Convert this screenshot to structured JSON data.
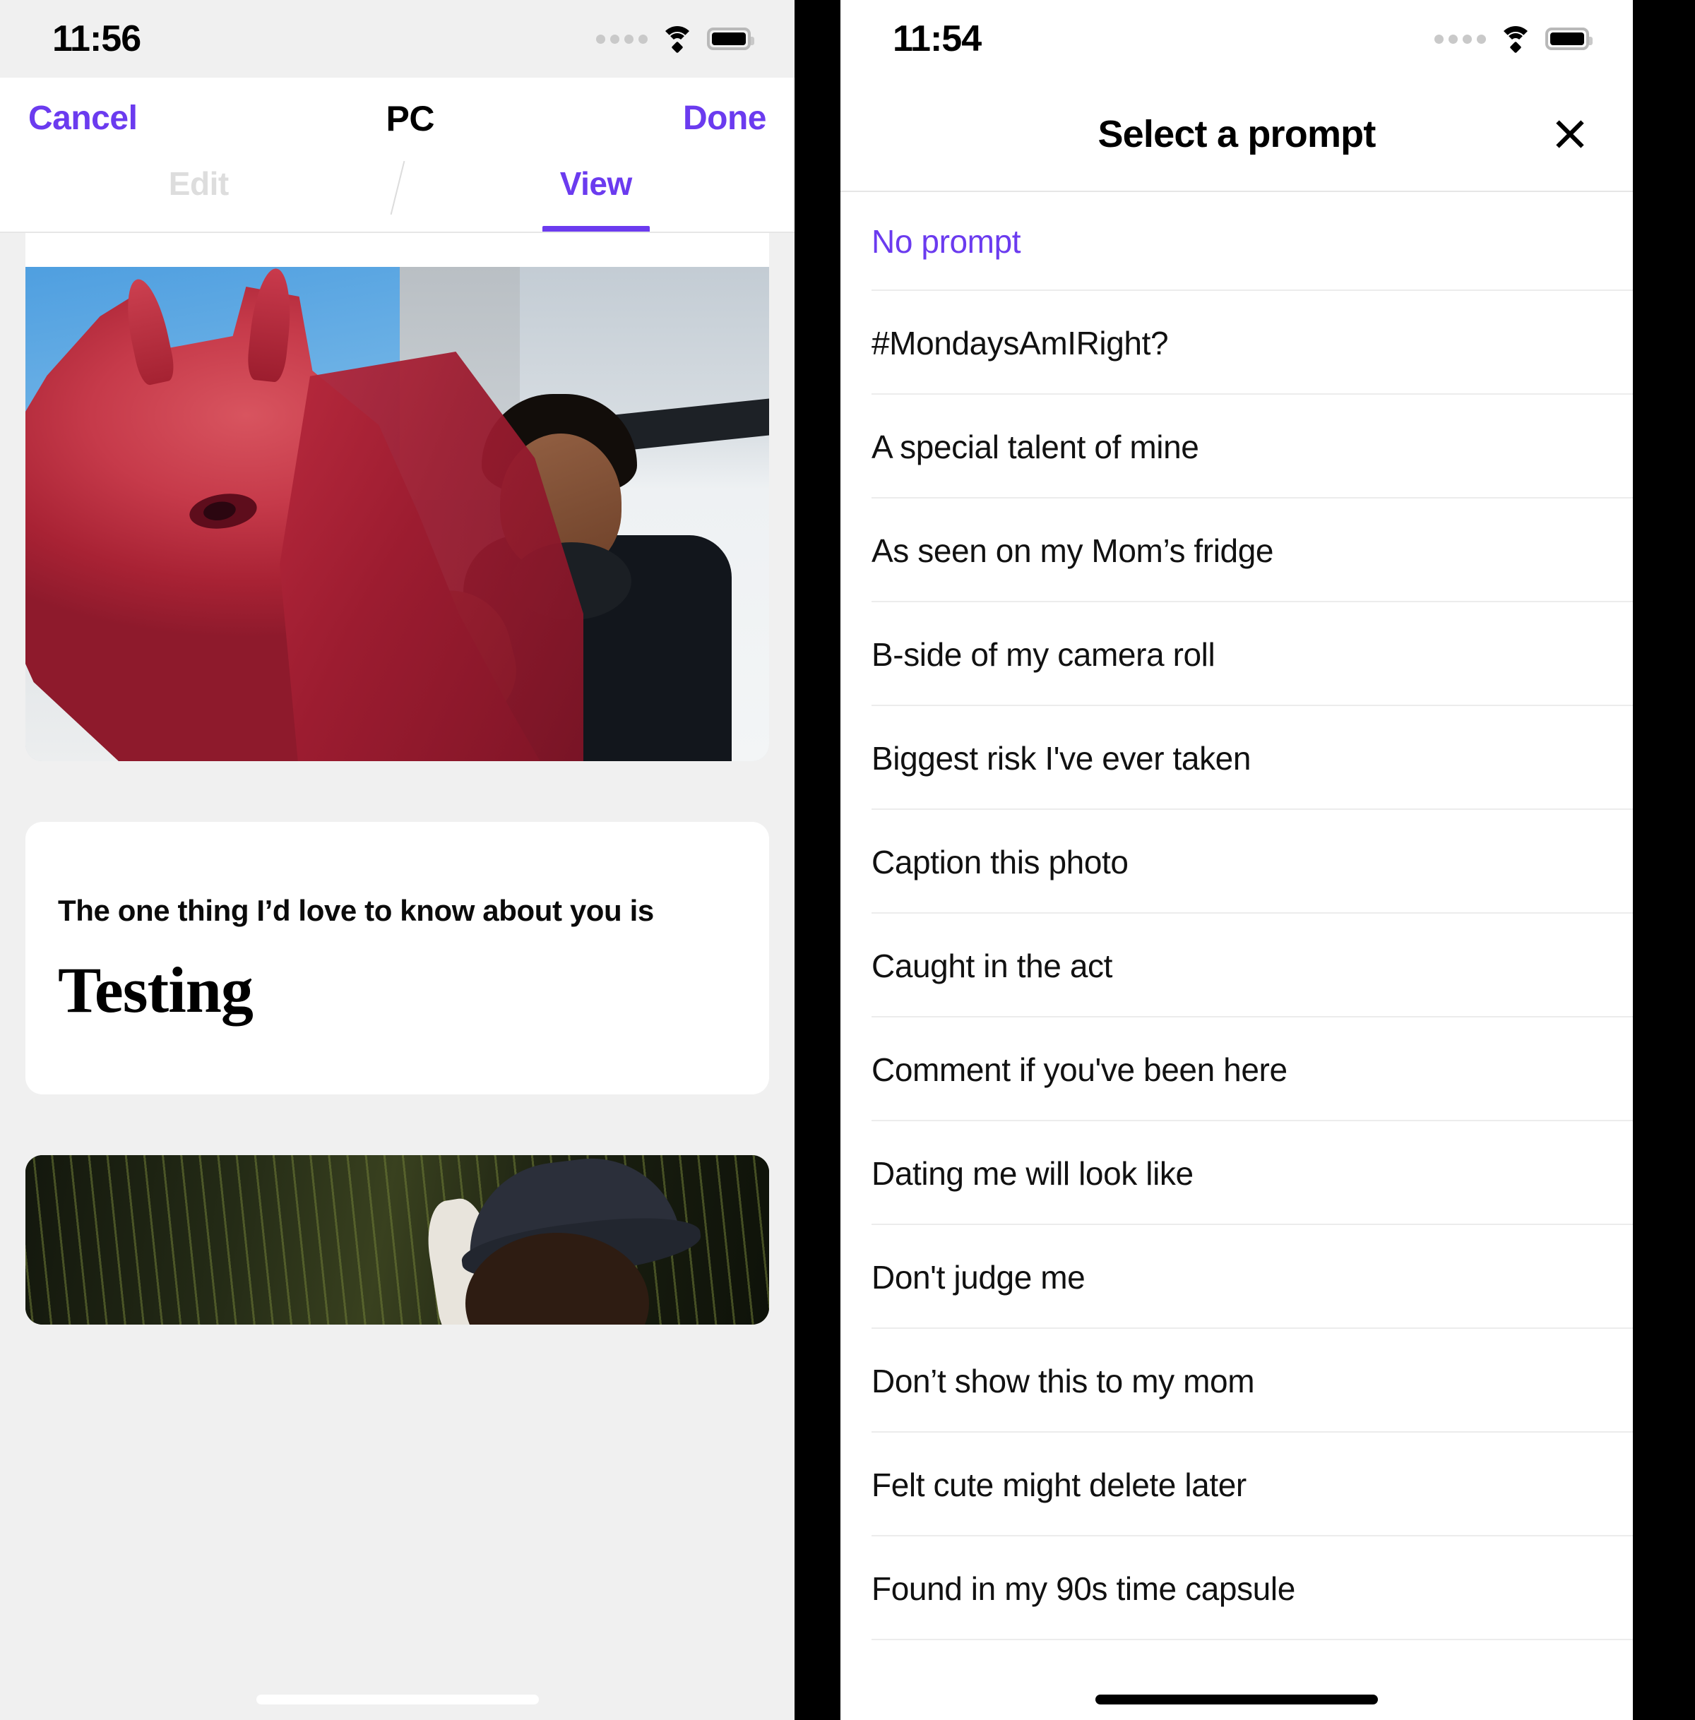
{
  "left_screen": {
    "status_bar": {
      "time": "11:56",
      "cellular_icon": "cellular-dots-icon",
      "wifi_icon": "wifi-icon",
      "battery_icon": "battery-full-icon"
    },
    "nav": {
      "cancel_label": "Cancel",
      "title": "PC",
      "done_label": "Done"
    },
    "tabs": [
      {
        "label": "Edit",
        "active": false
      },
      {
        "label": "View",
        "active": true
      }
    ],
    "prompt_card": {
      "prompt_label": "The one thing I’d love to know about you is",
      "answer": "Testing"
    },
    "colors": {
      "accent": "#6B3BEF",
      "background": "#F0F0F0",
      "card": "#FFFFFF"
    }
  },
  "right_screen": {
    "status_bar": {
      "time": "11:54",
      "cellular_icon": "cellular-dots-icon",
      "wifi_icon": "wifi-icon",
      "battery_icon": "battery-full-icon"
    },
    "sheet": {
      "title": "Select a prompt",
      "close_icon": "close-x-icon"
    },
    "prompts": [
      {
        "label": "No prompt",
        "highlighted": true
      },
      {
        "label": "#MondaysAmIRight?",
        "highlighted": false
      },
      {
        "label": "A special talent of mine",
        "highlighted": false
      },
      {
        "label": "As seen on my Mom’s fridge",
        "highlighted": false
      },
      {
        "label": "B-side of my camera roll",
        "highlighted": false
      },
      {
        "label": "Biggest risk I've ever taken",
        "highlighted": false
      },
      {
        "label": "Caption this photo",
        "highlighted": false
      },
      {
        "label": "Caught in the act",
        "highlighted": false
      },
      {
        "label": "Comment if you've been here",
        "highlighted": false
      },
      {
        "label": "Dating me will look like",
        "highlighted": false
      },
      {
        "label": "Don't judge me",
        "highlighted": false
      },
      {
        "label": "Don’t show this to my mom",
        "highlighted": false
      },
      {
        "label": "Felt cute might delete later",
        "highlighted": false
      },
      {
        "label": "Found in my 90s time capsule",
        "highlighted": false
      }
    ],
    "colors": {
      "accent": "#6B3BEF",
      "divider": "#ECECEC"
    }
  }
}
